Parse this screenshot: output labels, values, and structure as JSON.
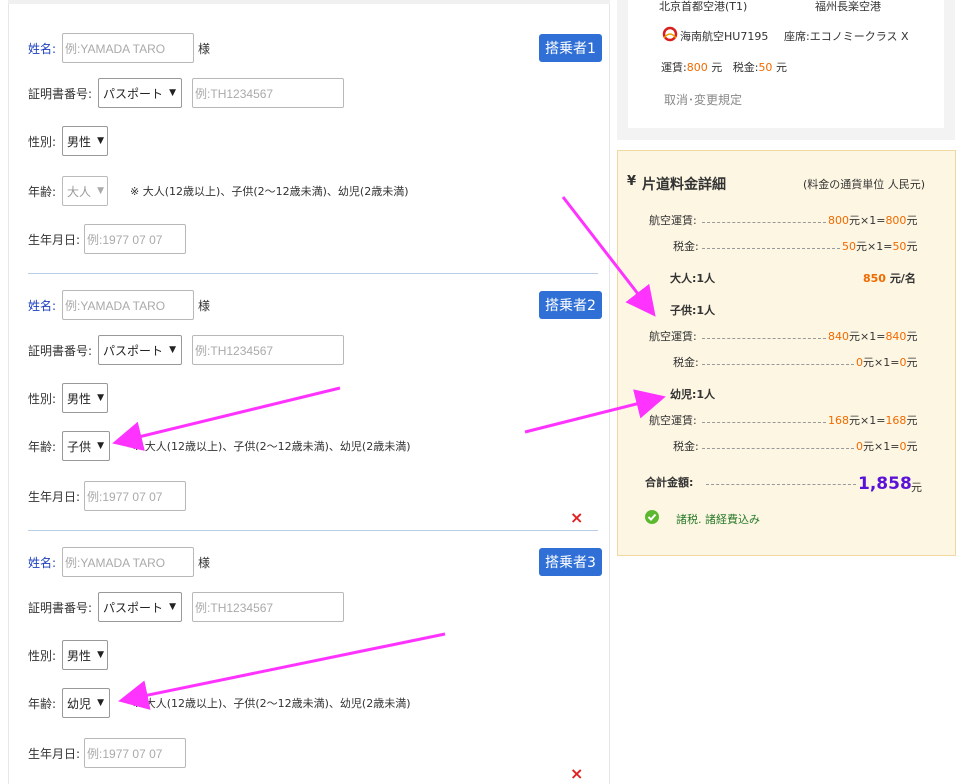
{
  "form": {
    "name_label": "姓名:",
    "name_placeholder": "例:YAMADA TARO",
    "name_suffix": "様",
    "id_label": "証明書番号:",
    "id_type": "パスポート",
    "id_placeholder": "例:TH1234567",
    "sex_label": "性別:",
    "sex_value": "男性",
    "age_label": "年齢:",
    "age_note": "※ 大人(12歳以上)、子供(2～12歳未満)、幼児(2歳未満)",
    "birth_label": "生年月日:",
    "birth_placeholder": "例:1977 07 07",
    "delete_icon": "×"
  },
  "passengers": [
    {
      "badge": "搭乗者1",
      "age_value": "大人"
    },
    {
      "badge": "搭乗者2",
      "age_value": "子供"
    },
    {
      "badge": "搭乗者3",
      "age_value": "幼児"
    }
  ],
  "flight": {
    "from_airport": "北京首都空港(T1)",
    "to_airport": "福州長楽空港",
    "airline": "海南航空HU7195",
    "seat": "座席:エコノミークラス X",
    "fare_label": "運賃:",
    "fare_value": "800",
    "fare_unit": "元",
    "tax_label": "税金:",
    "tax_value": "50",
    "tax_unit": "元",
    "rules_link": "取消･変更規定"
  },
  "price": {
    "currency_icon": "¥",
    "title": "片道料金詳細",
    "currency_note": "(料金の通貨単位 人民元)",
    "adult": {
      "fare_label": "航空運賃:",
      "fare_amount": "800",
      "fare_mult": "元×1=",
      "fare_total": "800",
      "tax_label": "税金:",
      "tax_amount": "50",
      "tax_mult": "元×1=",
      "tax_total": "50",
      "unit": "元",
      "summary_label": "大人:1人",
      "summary_amount": "850",
      "summary_unit": "元/名"
    },
    "child": {
      "summary_label": "子供:1人",
      "fare_label": "航空運賃:",
      "fare_amount": "840",
      "fare_mult": "元×1=",
      "fare_total": "840",
      "tax_label": "税金:",
      "tax_amount": "0",
      "tax_mult": "元×1=",
      "tax_total": "0",
      "unit": "元"
    },
    "infant": {
      "summary_label": "幼児:1人",
      "fare_label": "航空運賃:",
      "fare_amount": "168",
      "fare_mult": "元×1=",
      "fare_total": "168",
      "tax_label": "税金:",
      "tax_amount": "0",
      "tax_mult": "元×1=",
      "tax_total": "0",
      "unit": "元"
    },
    "total_label": "合計金額:",
    "total_value": "1,858",
    "total_unit": "元",
    "included_note": "諸税. 諸経費込み"
  },
  "colors": {
    "badge": "#2f6fd6",
    "accent_orange": "#f06a00",
    "total_purple": "#5a12d8",
    "arrow": "#ff33ff",
    "price_bg": "#fdf6e3"
  }
}
